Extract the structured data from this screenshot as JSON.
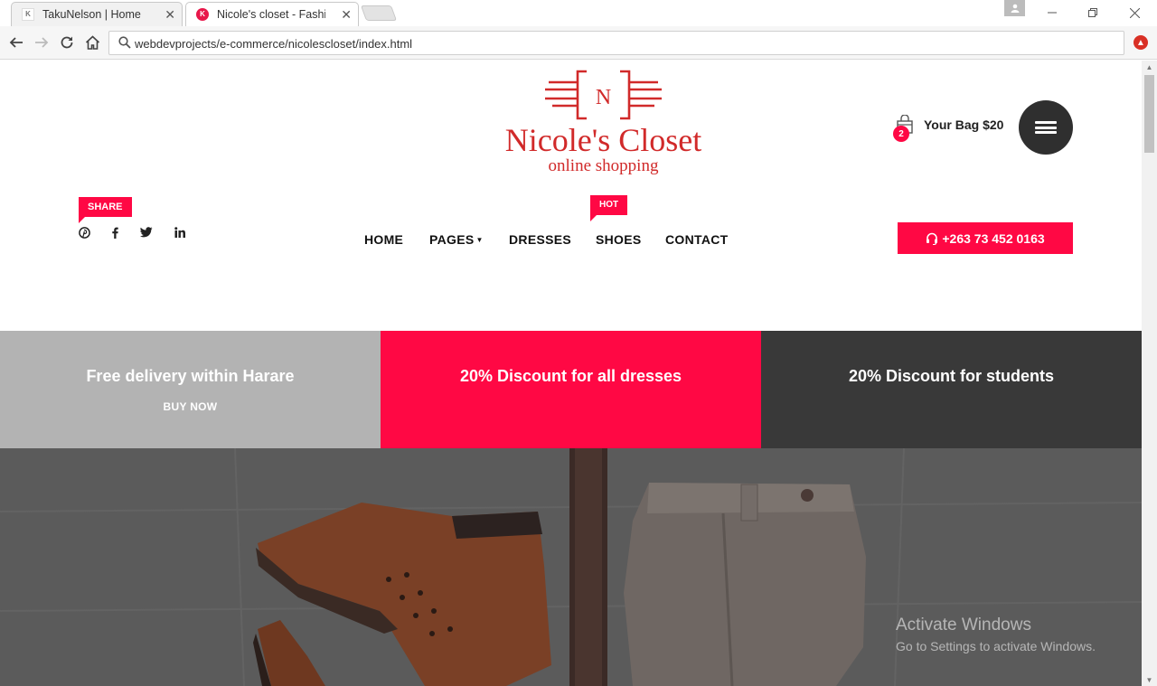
{
  "browser": {
    "tabs": [
      {
        "title": "TakuNelson | Home",
        "favicon": "K"
      },
      {
        "title": "Nicole's closet - Fashion",
        "favicon": "K"
      }
    ],
    "url": "webdevprojects/e-commerce/nicolescloset/index.html"
  },
  "header": {
    "logo_letter": "N",
    "logo_name": "Nicole's Closet",
    "logo_tagline": "online shopping",
    "bag_count": "2",
    "bag_label": "Your Bag $20",
    "share_label": "SHARE",
    "social_icons": [
      "pinterest-icon",
      "facebook-icon",
      "twitter-icon",
      "linkedin-icon"
    ],
    "nav": [
      "HOME",
      "PAGES",
      "DRESSES",
      "SHOES",
      "CONTACT"
    ],
    "hot_label": "HOT",
    "phone": "+263 73 452 0163"
  },
  "promos": [
    {
      "title": "Free delivery within Harare",
      "link": "BUY NOW",
      "color": "#b3b3b3"
    },
    {
      "title": "20% Discount for all dresses",
      "link": "",
      "color": "#ff0844"
    },
    {
      "title": "20% Discount for students",
      "link": "",
      "color": "#393939"
    }
  ],
  "watermark": {
    "title": "Activate Windows",
    "subtitle": "Go to Settings to activate Windows."
  },
  "colors": {
    "accent": "#ff0844",
    "logo": "#d12a2a",
    "dark": "#2f2f2f"
  }
}
